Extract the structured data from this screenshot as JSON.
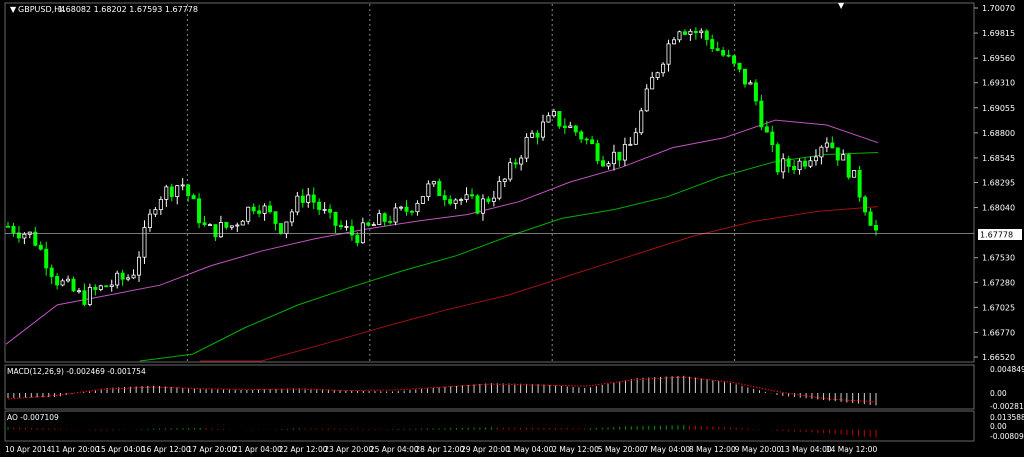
{
  "window": {
    "symbol_label": "GBPUSD,H4",
    "ohlc_label": "1.68082 1.68202 1.67593 1.67778"
  },
  "indicators": {
    "macd_label": "MACD(12,26,9) -0.002469 -0.001754",
    "ao_label": "AO -0.007109",
    "macd_axis": [
      "0.004849",
      "0.00",
      "-0.002817"
    ],
    "ao_axis": [
      "0.013588",
      "0.00",
      "-0.008094"
    ]
  },
  "current_price_label": "1.67778",
  "colors": {
    "background": "#000000",
    "bull_candle": "#ffffff",
    "bear_candle": "#00ff00",
    "ma_fast": "#c154c1",
    "ma_mid": "#00b000",
    "ma_slow": "#a01010",
    "macd_signal": "#ff0000",
    "ao_up": "#00a000",
    "ao_down": "#c00000",
    "price_line": "#c0c0c0"
  },
  "chart_data": {
    "type": "candlestick",
    "y_ticks": [
      "1.70070",
      "1.69815",
      "1.69560",
      "1.69310",
      "1.69055",
      "1.68800",
      "1.68545",
      "1.68295",
      "1.68040",
      "1.67778",
      "1.67530",
      "1.67280",
      "1.67025",
      "1.66770",
      "1.66520"
    ],
    "ylim": [
      1.6652,
      1.7007
    ],
    "x_ticks": [
      "10 Apr 2014",
      "11 Apr 20:00",
      "15 Apr 04:00",
      "16 Apr 12:00",
      "17 Apr 20:00",
      "21 Apr 04:00",
      "22 Apr 12:00",
      "23 Apr 20:00",
      "25 Apr 04:00",
      "28 Apr 12:00",
      "29 Apr 20:00",
      "1 May 04:00",
      "2 May 12:00",
      "5 May 20:00",
      "7 May 04:00",
      "8 May 12:00",
      "9 May 20:00",
      "13 May 04:00",
      "14 May 12:00"
    ],
    "close_anchors": [
      1.6785,
      1.6775,
      1.673,
      1.6712,
      1.6725,
      1.6735,
      1.6815,
      1.683,
      1.678,
      1.6785,
      1.681,
      1.6785,
      1.682,
      1.679,
      1.6775,
      1.679,
      1.68,
      1.6825,
      1.6815,
      1.6805,
      1.683,
      1.6875,
      1.6895,
      1.688,
      1.6855,
      1.686,
      1.6935,
      1.699,
      1.698,
      1.6955,
      1.6925,
      1.6845,
      1.685,
      1.6875,
      1.684,
      1.678
    ],
    "ma_fast_anchors": [
      1.6665,
      1.6705,
      1.6715,
      1.6725,
      1.6745,
      1.676,
      1.6772,
      1.6782,
      1.679,
      1.6797,
      1.681,
      1.683,
      1.6845,
      1.6865,
      1.6875,
      1.6893,
      1.6888,
      1.687
    ],
    "ma_mid_anchors": [
      1.662,
      1.6655,
      1.6682,
      1.6705,
      1.6723,
      1.674,
      1.6755,
      1.6775,
      1.6793,
      1.6802,
      1.6815,
      1.6835,
      1.685,
      1.6858,
      1.686
    ],
    "ma_slow_anchors": [
      1.662,
      1.6645,
      1.6665,
      1.6683,
      1.67,
      1.6715,
      1.6735,
      1.6755,
      1.6775,
      1.679,
      1.68,
      1.6805
    ],
    "macd_anchors": [
      -0.001,
      -0.0008,
      0.001,
      0.0015,
      0.0008,
      0.0006,
      0.001,
      0.0005,
      0.0003,
      0.0012,
      0.002,
      0.0018,
      0.001,
      0.003,
      0.0035,
      0.002,
      -0.0005,
      -0.0015,
      -0.0025
    ],
    "macd_signal_anchors": [
      -0.0012,
      -0.0005,
      0.0008,
      0.0012,
      0.0009,
      0.0007,
      0.0008,
      0.0005,
      0.0006,
      0.0012,
      0.0018,
      0.0016,
      0.0014,
      0.0027,
      0.0032,
      0.0022,
      0.0002,
      -0.0012,
      -0.0018
    ],
    "ao_anchors": [
      0.002,
      0.001,
      -0.001,
      0.001,
      0.0015,
      -0.0005,
      0.001,
      0.0008,
      0.0005,
      0.0012,
      0.002,
      0.0015,
      0.001,
      0.003,
      0.004,
      0.002,
      -0.001,
      -0.003,
      -0.007
    ]
  }
}
